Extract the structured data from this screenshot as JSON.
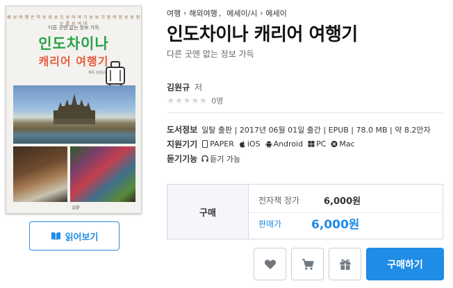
{
  "breadcrumb": {
    "items": [
      "여행",
      "해외여행",
      "에세이/시",
      "에세이"
    ],
    "comma": ","
  },
  "book": {
    "title": "인도차이나 캐리어 여행기",
    "description": "다른 곳엔 없는 정보 가득",
    "author": "김원규",
    "author_role": "저",
    "rating_count": "0명",
    "stars": "★★★★★"
  },
  "cover": {
    "tagline": "베 보 여 행 은 역 보 네 보 오 보 러 여 기 보 보 가 정 여 형 보 보 정 는 를 보 여 네",
    "subtitle": "다른 곳엔 없는 정보 가득",
    "title_line1": "인도차이나",
    "title_line2": "캐리어 여행기",
    "author": "제목 김원규",
    "publisher": "일탈"
  },
  "info": {
    "book_info_label": "도서정보",
    "book_info_value": "일탈 출판 | 2017년 06월 01일 출간 | EPUB | 78.0 MB | 약 8.2만자",
    "devices_label": "지원기기",
    "devices": [
      {
        "icon": "paper-icon",
        "label": "PAPER"
      },
      {
        "icon": "apple-icon",
        "label": "iOS"
      },
      {
        "icon": "android-icon",
        "label": "Android"
      },
      {
        "icon": "windows-icon",
        "label": "PC"
      },
      {
        "icon": "mac-icon",
        "label": "Mac"
      }
    ],
    "listen_label": "듣기기능",
    "listen_value": "듣기 가능"
  },
  "price": {
    "section_label": "구매",
    "list_price_label": "전자책 정가",
    "list_price": "6,000원",
    "sale_price_label": "판매가",
    "sale_price": "6,000원"
  },
  "buttons": {
    "read": "읽어보기",
    "buy": "구매하기"
  },
  "colors": {
    "accent": "#1f8ce6",
    "star_empty": "#d9d9d9"
  }
}
